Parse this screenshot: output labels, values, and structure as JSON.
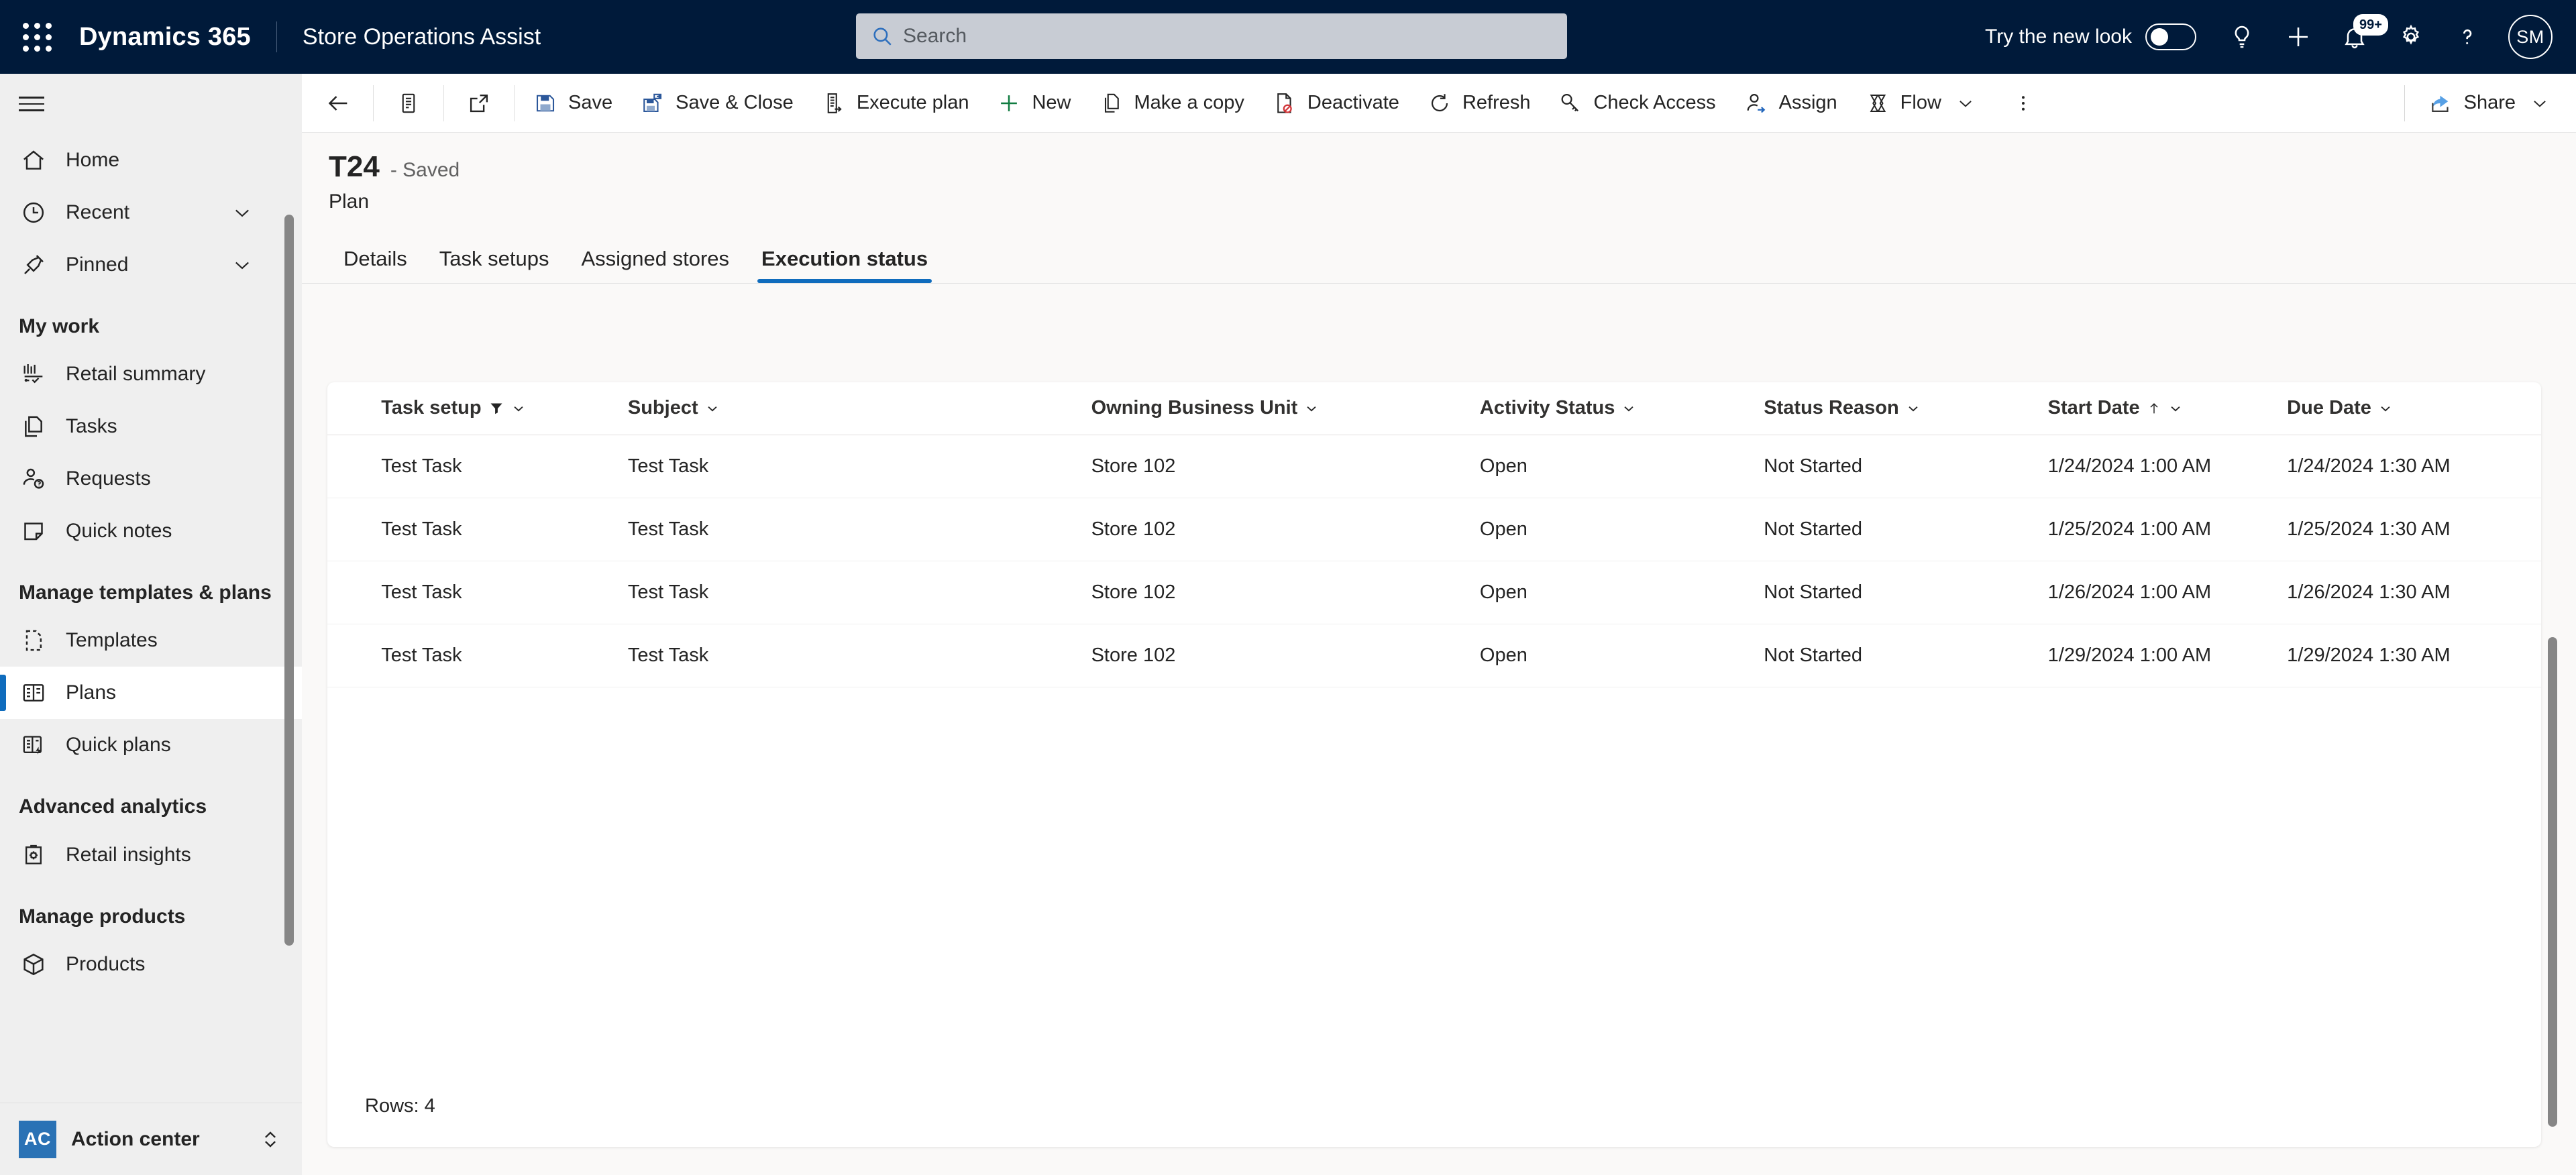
{
  "header": {
    "waffle_label": "app-launcher",
    "brand": "Dynamics 365",
    "app_name": "Store Operations Assist",
    "search": {
      "placeholder": "Search",
      "value": ""
    },
    "new_look_label": "Try the new look",
    "new_look_state": "off",
    "notifications_badge": "99+",
    "avatar_initials": "SM",
    "icons": [
      "search-icon",
      "lightbulb-icon",
      "plus-icon",
      "bell-icon",
      "gear-icon",
      "question-icon",
      "avatar"
    ]
  },
  "sidebar": {
    "hamburger_label": "site-map-toggle",
    "items": [
      {
        "label": "Home",
        "icon": "home-icon",
        "expandable": false,
        "selected": false
      },
      {
        "label": "Recent",
        "icon": "clock-icon",
        "expandable": true,
        "selected": false
      },
      {
        "label": "Pinned",
        "icon": "pin-icon",
        "expandable": true,
        "selected": false
      }
    ],
    "groups": [
      {
        "title": "My work",
        "items": [
          {
            "label": "Retail summary",
            "icon": "chart-icon",
            "selected": false
          },
          {
            "label": "Tasks",
            "icon": "tasks-icon",
            "selected": false
          },
          {
            "label": "Requests",
            "icon": "request-icon",
            "selected": false
          },
          {
            "label": "Quick notes",
            "icon": "note-icon",
            "selected": false
          }
        ]
      },
      {
        "title": "Manage templates & plans",
        "items": [
          {
            "label": "Templates",
            "icon": "template-icon",
            "selected": false
          },
          {
            "label": "Plans",
            "icon": "plans-icon",
            "selected": true
          },
          {
            "label": "Quick plans",
            "icon": "quick-plans-icon",
            "selected": false
          }
        ]
      },
      {
        "title": "Advanced analytics",
        "items": [
          {
            "label": "Retail insights",
            "icon": "insights-icon",
            "selected": false
          }
        ]
      },
      {
        "title": "Manage products",
        "items": [
          {
            "label": "Products",
            "icon": "box-icon",
            "selected": false
          }
        ]
      }
    ],
    "action_center": {
      "badge": "AC",
      "label": "Action center"
    }
  },
  "commandbar": {
    "back_label": "back-arrow",
    "form_selector_label": "form-selector",
    "popout_label": "open-in-new-window",
    "items": [
      {
        "label": "Save",
        "icon": "save-icon"
      },
      {
        "label": "Save & Close",
        "icon": "save-close-icon"
      },
      {
        "label": "Execute plan",
        "icon": "execute-icon"
      },
      {
        "label": "New",
        "icon": "plus-icon"
      },
      {
        "label": "Make a copy",
        "icon": "copy-icon"
      },
      {
        "label": "Deactivate",
        "icon": "deactivate-icon"
      },
      {
        "label": "Refresh",
        "icon": "refresh-icon"
      },
      {
        "label": "Check Access",
        "icon": "key-icon"
      },
      {
        "label": "Assign",
        "icon": "assign-icon"
      },
      {
        "label": "Flow",
        "icon": "flow-icon",
        "has_chevron": true
      }
    ],
    "overflow_label": "More commands",
    "share": {
      "label": "Share",
      "icon": "share-icon",
      "has_chevron": true
    }
  },
  "record": {
    "title": "T24",
    "saved_state": "- Saved",
    "entity": "Plan"
  },
  "tabs": [
    {
      "label": "Details",
      "active": false
    },
    {
      "label": "Task setups",
      "active": false
    },
    {
      "label": "Assigned stores",
      "active": false
    },
    {
      "label": "Execution status",
      "active": true
    }
  ],
  "grid": {
    "columns": [
      {
        "key": "task_setup",
        "label": "Task setup",
        "filtered": true,
        "sorted": "",
        "has_chevron": true
      },
      {
        "key": "subject",
        "label": "Subject",
        "filtered": false,
        "sorted": "",
        "has_chevron": true
      },
      {
        "key": "owning_business_unit",
        "label": "Owning Business Unit",
        "filtered": false,
        "sorted": "",
        "has_chevron": true
      },
      {
        "key": "activity_status",
        "label": "Activity Status",
        "filtered": false,
        "sorted": "",
        "has_chevron": true
      },
      {
        "key": "status_reason",
        "label": "Status Reason",
        "filtered": false,
        "sorted": "",
        "has_chevron": true
      },
      {
        "key": "start_date",
        "label": "Start Date",
        "filtered": false,
        "sorted": "asc",
        "has_chevron": true
      },
      {
        "key": "due_date",
        "label": "Due Date",
        "filtered": false,
        "sorted": "",
        "has_chevron": true
      }
    ],
    "rows": [
      {
        "task_setup": "Test Task",
        "subject": "Test Task",
        "owning_business_unit": "Store 102",
        "activity_status": "Open",
        "status_reason": "Not Started",
        "start_date": "1/24/2024 1:00 AM",
        "due_date": "1/24/2024 1:30 AM"
      },
      {
        "task_setup": "Test Task",
        "subject": "Test Task",
        "owning_business_unit": "Store 102",
        "activity_status": "Open",
        "status_reason": "Not Started",
        "start_date": "1/25/2024 1:00 AM",
        "due_date": "1/25/2024 1:30 AM"
      },
      {
        "task_setup": "Test Task",
        "subject": "Test Task",
        "owning_business_unit": "Store 102",
        "activity_status": "Open",
        "status_reason": "Not Started",
        "start_date": "1/26/2024 1:00 AM",
        "due_date": "1/26/2024 1:30 AM"
      },
      {
        "task_setup": "Test Task",
        "subject": "Test Task",
        "owning_business_unit": "Store 102",
        "activity_status": "Open",
        "status_reason": "Not Started",
        "start_date": "1/29/2024 1:00 AM",
        "due_date": "1/29/2024 1:30 AM"
      }
    ],
    "footer": "Rows: 4"
  },
  "colors": {
    "appbar_bg": "#001a3a",
    "accent": "#0f6cbd",
    "link": "#2266bb",
    "sidebar_bg": "#efefef",
    "canvas_bg": "#faf9f8",
    "action_center_badge": "#2a72b5"
  }
}
